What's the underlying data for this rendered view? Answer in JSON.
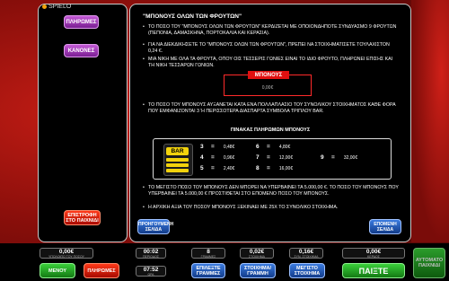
{
  "brand": "SPIELO",
  "left": {
    "paytable_btn": "ΠΛΗΡΩΜΕΣ",
    "rules_btn": "ΚΑΝΟΝΕΣ",
    "back_btn_l1": "ΕΠΙΣΤΡΟΦΗ",
    "back_btn_l2": "ΣΤΟ ΠΑΙΧΝΙΔΙ"
  },
  "main": {
    "title": "\"ΜΠΟΝΟΥΣ ΟΛΩΝ ΤΩΝ ΦΡΟΥΤΩΝ\"",
    "rules": [
      "ΤΟ ΠΟΣΟ ΤΟΥ \"ΜΠΟΝΟΥΣ ΟΛΩΝ ΤΩΝ ΦΡΟΥΤΩΝ\" ΚΕΡΔΙΖΕΤΑΙ ΜΕ ΟΠΟΙΟΝΔΗΠΟΤΕ ΣΥΝΔΥΑΣΜΟ 9 ΦΡΟΥΤΩΝ (ΠΕΠΟΝΙΑ, ΔΑΜΑΣΚΗΝΑ, ΠΟΡΤΟΚΑΛΙΑ ΚΑΙ ΚΕΡΑΣΙΑ).",
      "ΓΙΑ ΝΑ ΔΙΕΚΔΙΚΗΣΕΤΕ ΤΟ \"ΜΠΟΝΟΥΣ ΟΛΩΝ ΤΩΝ ΦΡΟΥΤΩΝ\", ΠΡΕΠΕΙ ΝΑ ΣΤΟΙΧΗΜΑΤΙΣΕΤΕ ΤΟΥΛΑΧΙΣΤΟΝ 0,24 €.",
      "ΜΙΑ ΝΙΚΗ ΜΕ ΟΛΑ ΤΑ ΦΡΟΥΤΑ, ΟΠΟΥ ΟΙΣ ΤΕΣΣΕΡΙΣ ΓΩΝΙΕΣ ΕΙΝΑΙ ΤΟ ΙΔΙΟ ΦΡΟΥΤΟ, ΠΛΗΡΩΝΕΙ ΕΠΙΣΗΣ ΚΑΙ ΤΗ ΝΙΚΗ ΤΕΣΣΑΡΩΝ ΓΩΝΙΩΝ."
    ],
    "bonus_label": "ΜΠΟΝΟΥΣ",
    "bonus_value": "0,00€",
    "rule_increase": "ΤΟ ΠΟΣΟ ΤΟΥ ΜΠΟΝΟΥΣ ΑΥΞΑΝΕΤΑΙ ΚΑΤΑ ΕΝΑ ΠΟΛΛΑΠΛΑΣΙΟ ΤΟΥ ΣΥΝΟΛΙΚΟΥ ΣΤΟΙΧΗΜΑΤΟΣ ΚΑΘΕ ΦΟΡΑ ΠΟΥ ΕΜΦΑΝΙΖΟΝΤΑΙ 3 Ή ΠΕΡΙΣΣΟΤΕΡΑ ΔΙΑΣΠΑΡΤΑ ΣΥΜΒΟΛΑ ΤΡΙΠΛΟΥ BAR.",
    "table_title": "ΠΙΝΑΚΑΣ ΠΛΗΡΩΜΩΝ ΜΠΟΝΟΥΣ",
    "bar_symbol": "BAR",
    "payouts": [
      {
        "n": "3",
        "eq": "=",
        "v": "0,48€"
      },
      {
        "n": "4",
        "eq": "=",
        "v": "0,96€"
      },
      {
        "n": "5",
        "eq": "=",
        "v": "2,40€"
      },
      {
        "n": "6",
        "eq": "=",
        "v": "4,80€"
      },
      {
        "n": "7",
        "eq": "=",
        "v": "12,00€"
      },
      {
        "n": "8",
        "eq": "=",
        "v": "16,00€"
      },
      {
        "n": "9",
        "eq": "=",
        "v": "32,00€"
      }
    ],
    "rule_max": "ΤΟ ΜΕΓΙΣΤΟ ΠΟΣΟ ΤΟΥ ΜΠΟΝΟΥΣ ΔΕΝ ΜΠΟΡΕΙ ΝΑ ΥΠΕΡΒΑΙΝΕΙ ΤΑ 5.000,00 €. ΤΟ ΠΟΣΟ ΤΟΥ ΜΠΟΝΟΥΣ ΠΟΥ ΥΠΕΡΒΑΙΝΕΙ ΤΑ 5.000,00 € ΠΡΟΣΤΙΘΕΤΑΙ ΣΤΟ ΕΠΟΜΕΝΟ ΠΟΣΟ ΤΟΥ ΜΠΟΝΟΥΣ.",
    "rule_start": "Η ΑΡΧΙΚΗ ΑΞΙΑ ΤΟΥ ΠΟΣΟΥ ΜΠΟΝΟΥΣ ΞΕΚΙΝΑΕΙ ΜΕ 25Χ ΤΟ ΣΥΝΟΛΙΚΟ ΣΤΟΙΧΗΜΑ.",
    "prev_l1": "ΠΡΟΗΓΟΥΜΕΝΗ",
    "prev_l2": "ΣΕΛΙΔΑ",
    "next_l1": "ΕΠΟΜΕΝΗ",
    "next_l2": "ΣΕΛΙΔΑ"
  },
  "bottom": {
    "balance": {
      "value": "0,00€",
      "caption": "ΥΠΟΛΟΙΠΟ ΤΟΥ ΠΟΣΟΥ"
    },
    "time1": {
      "value": "00:02",
      "caption": "ΠΕΡΙΟΔΟΣ"
    },
    "time2": {
      "value": "07:52",
      "caption": "ΩΡΑ"
    },
    "lines": {
      "value": "8",
      "caption": "ΓΡΑΜΜΕΣ"
    },
    "bet_line": {
      "value": "0,02€",
      "caption": "ΣΤΟΙΧΗΜΑ"
    },
    "total_bet": {
      "value": "0,16€",
      "caption": "ΣΥΝ. ΣΤΟΙΧΗΜΑ"
    },
    "win": {
      "value": "0,00€",
      "caption": "ΚΕΡΔΟΣ"
    },
    "menu_btn": "ΜΕΝΟΥ",
    "paytable_btn": "ΠΛΗΡΩΜΕΣ",
    "select_lines_l1": "ΕΠΙΛΕΞΤΕ",
    "select_lines_l2": "ΓΡΑΜΜΕΣ",
    "bet_line_l1": "ΣΤΟΙΧΗΜΑ/",
    "bet_line_l2": "ΓΡΑΜΜΗ",
    "max_bet_l1": "ΜΕΓΙΣΤΟ",
    "max_bet_l2": "ΣΤΟΙΧΗΜΑ",
    "play_btn": "ΠΑΙΞΤΕ",
    "autoplay_l1": "ΑΥΤΟΜΑΤΟ",
    "autoplay_l2": "ΠΑΙΧΝΙΔΙ"
  }
}
